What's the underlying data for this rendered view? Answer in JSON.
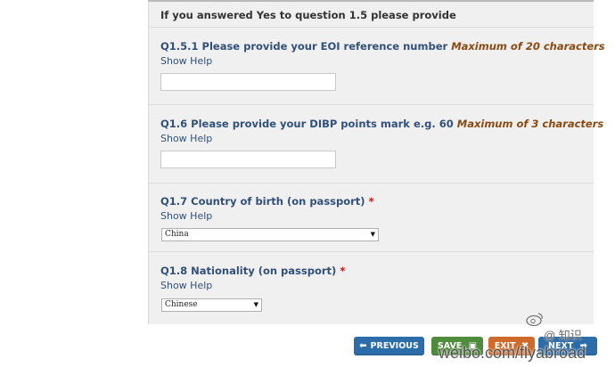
{
  "section": {
    "heading": "If you answered Yes to question 1.5 please provide"
  },
  "questions": [
    {
      "title": "Q1.5.1 Please provide your EOI reference number",
      "note": "Maximum of 20 characters",
      "help": "Show Help",
      "value": ""
    },
    {
      "title": "Q1.6 Please provide your DIBP points mark e.g. 60",
      "note": "Maximum of 3 characters",
      "help": "Show Help",
      "value": ""
    },
    {
      "title": "Q1.7 Country of birth (on passport)",
      "required": "*",
      "help": "Show Help",
      "selected": "China"
    },
    {
      "title": "Q1.8 Nationality (on passport)",
      "required": "*",
      "help": "Show Help",
      "selected": "Chinese"
    }
  ],
  "buttons": {
    "previous": "PREVIOUS",
    "save": "SAVE",
    "exit": "EXIT",
    "next": "NEXT"
  },
  "watermark": {
    "text": "weibo.com/flyabroad",
    "handle": "@ 知识"
  },
  "colors": {
    "question_text": "#31507a",
    "max_note": "#8a4b12",
    "required": "#c21a1a",
    "btn_blue": "#2c6ca8",
    "btn_green": "#4e8b3b",
    "btn_orange": "#d06a2a"
  }
}
